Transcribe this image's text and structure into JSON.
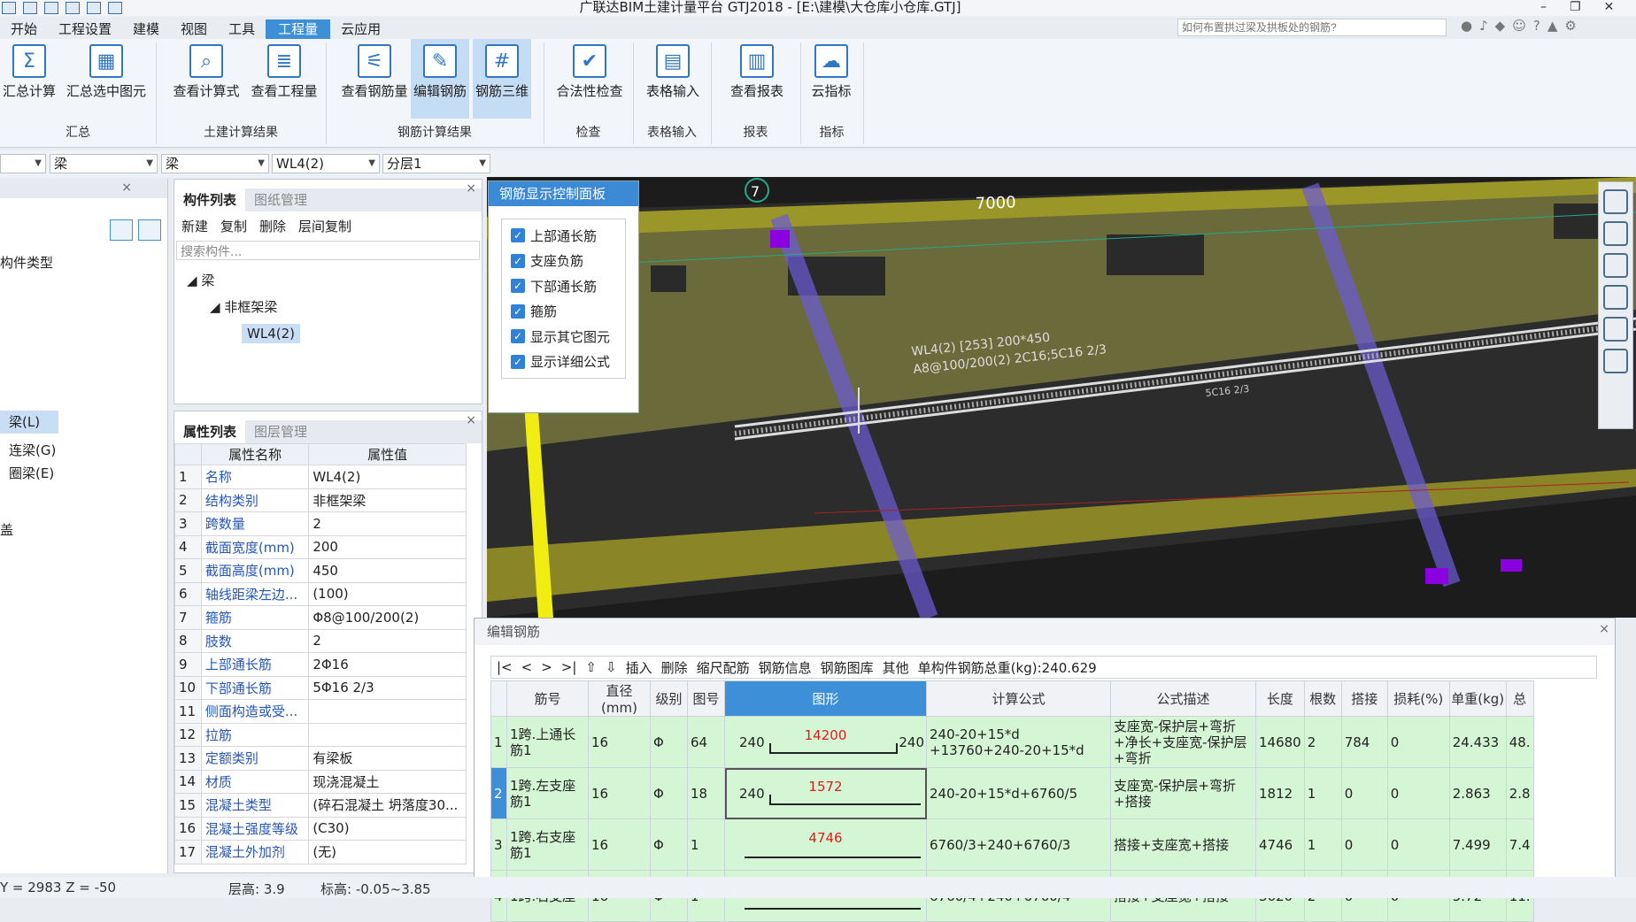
{
  "app": {
    "title": "广联达BIM土建计量平台 GTJ2018 - [E:\\建模\\大仓库小仓库.GTJ]",
    "search_placeholder": "如何布置拱过梁及拱板处的钢筋?"
  },
  "menu": [
    "开始",
    "工程设置",
    "建模",
    "视图",
    "工具",
    "工程量",
    "云应用"
  ],
  "ribbon": {
    "buttons": [
      "汇总计算",
      "汇总选中图元",
      "查看计算式",
      "查看工程量",
      "查看钢筋量",
      "编辑钢筋",
      "钢筋三维",
      "合法性检查",
      "表格输入",
      "查看报表",
      "云指标"
    ],
    "groups": [
      "汇总",
      "土建计算结果",
      "钢筋计算结果",
      "检查",
      "表格输入",
      "报表",
      "指标"
    ]
  },
  "filters": [
    "",
    "梁",
    "梁",
    "WL4(2)",
    "分层1"
  ],
  "left": {
    "items": [
      "构件类型",
      "梁(L)",
      "连梁(G)",
      "圈梁(E)",
      "盖"
    ]
  },
  "complist": {
    "tabs": [
      "构件列表",
      "图纸管理"
    ],
    "toolbar": [
      "新建",
      "复制",
      "删除",
      "层间复制"
    ],
    "search": "搜索构件...",
    "tree": [
      "梁",
      "非框架梁",
      "WL4(2)"
    ]
  },
  "props": {
    "tabs": [
      "属性列表",
      "图层管理"
    ],
    "headers": [
      "属性名称",
      "属性值"
    ],
    "rows": [
      [
        "1",
        "名称",
        "WL4(2)"
      ],
      [
        "2",
        "结构类别",
        "非框架梁"
      ],
      [
        "3",
        "跨数量",
        "2"
      ],
      [
        "4",
        "截面宽度(mm)",
        "200"
      ],
      [
        "5",
        "截面高度(mm)",
        "450"
      ],
      [
        "6",
        "轴线距梁左边...",
        "(100)"
      ],
      [
        "7",
        "箍筋",
        "Φ8@100/200(2)"
      ],
      [
        "8",
        "肢数",
        "2"
      ],
      [
        "9",
        "上部通长筋",
        "2Φ16"
      ],
      [
        "10",
        "下部通长筋",
        "5Φ16 2/3"
      ],
      [
        "11",
        "侧面构造或受...",
        ""
      ],
      [
        "12",
        "拉筋",
        ""
      ],
      [
        "13",
        "定额类别",
        "有梁板"
      ],
      [
        "14",
        "材质",
        "现浇混凝土"
      ],
      [
        "15",
        "混凝土类型",
        "(碎石混凝土 坍落度30..."
      ],
      [
        "16",
        "混凝土强度等级",
        "(C30)"
      ],
      [
        "17",
        "混凝土外加剂",
        "(无)"
      ]
    ]
  },
  "viewport": {
    "axis": "7",
    "dim": "7000",
    "label1": "WL4(2) [253] 200*450",
    "label2": "A8@100/200(2) 2C16;5C16 2/3",
    "label3": "5C16 2/3"
  },
  "ctrl": {
    "title": "钢筋显示控制面板",
    "items": [
      "上部通长筋",
      "支座负筋",
      "下部通长筋",
      "箍筋",
      "显示其它图元",
      "显示详细公式"
    ]
  },
  "rebar": {
    "title": "编辑钢筋",
    "toolbar": [
      "插入",
      "删除",
      "缩尺配筋",
      "钢筋信息",
      "钢筋图库",
      "其他",
      "单构件钢筋总重(kg):240.629"
    ],
    "headers": [
      "筋号",
      "直径(mm)",
      "级别",
      "图号",
      "图形",
      "计算公式",
      "公式描述",
      "长度",
      "根数",
      "搭接",
      "损耗(%)",
      "单重(kg)",
      "总"
    ],
    "rows": [
      {
        "n": "1",
        "name": "1跨.上通长筋1",
        "d": "16",
        "lvl": "Φ",
        "fig": "64",
        "shape": [
          "240",
          "14200",
          "240"
        ],
        "formula": "240-20+15*d +13760+240-20+15*d",
        "desc": "支座宽-保护层+弯折+净长+支座宽-保护层+弯折",
        "len": "14680",
        "cnt": "2",
        "lap": "784",
        "loss": "0",
        "w": "24.433",
        "tw": "48."
      },
      {
        "n": "2",
        "name": "1跨.左支座筋1",
        "d": "16",
        "lvl": "Φ",
        "fig": "18",
        "shape": [
          "240",
          "1572",
          ""
        ],
        "formula": "240-20+15*d+6760/5",
        "desc": "支座宽-保护层+弯折+搭接",
        "len": "1812",
        "cnt": "1",
        "lap": "0",
        "loss": "0",
        "w": "2.863",
        "tw": "2.8"
      },
      {
        "n": "3",
        "name": "1跨.右支座筋1",
        "d": "16",
        "lvl": "Φ",
        "fig": "1",
        "shape": [
          "",
          "4746",
          ""
        ],
        "formula": "6760/3+240+6760/3",
        "desc": "搭接+支座宽+搭接",
        "len": "4746",
        "cnt": "1",
        "lap": "0",
        "loss": "0",
        "w": "7.499",
        "tw": "7.4"
      },
      {
        "n": "4",
        "name": "1跨.右支座",
        "d": "16",
        "lvl": "Φ",
        "fig": "1",
        "shape": [
          "",
          "3620",
          ""
        ],
        "formula": "6760/4+240+6760/4",
        "desc": "搭接+支座宽+搭接",
        "len": "3620",
        "cnt": "2",
        "lap": "0",
        "loss": "0",
        "w": "5.72",
        "tw": "11."
      }
    ]
  },
  "status": {
    "coords": "Y = 2983 Z = -50",
    "floor": "层高:  3.9",
    "elev": "标高:  -0.05~3.85"
  }
}
